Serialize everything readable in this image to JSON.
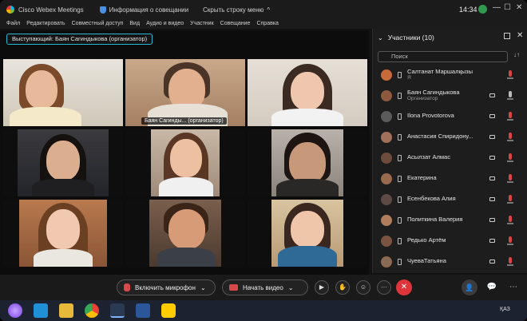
{
  "titlebar": {
    "app_title": "Cisco Webex Meetings",
    "info_label": "Информация о совещании",
    "hide_label": "Скрыть строку меню",
    "hide_chevron": "^",
    "clock": "14:34",
    "minimize": "—",
    "maximize": "☐",
    "close": "✕"
  },
  "menu": [
    "Файл",
    "Редактировать",
    "Совместный доступ",
    "Вид",
    "Аудио и видео",
    "Участник",
    "Совещание",
    "Справка"
  ],
  "stage": {
    "speaker_label": "Выступающий: Баян Сагиндыкова (организатор)",
    "active_tag": "Баян Сагинды... (организатор)"
  },
  "panel": {
    "chevron": "⌄",
    "title": "Участники (10)",
    "popout": "",
    "close": "✕",
    "search_placeholder": "Поиск",
    "sort": "↓↑",
    "participants": [
      {
        "name": "Салтанат Маршалқызы",
        "role": "Я",
        "mic_on": false
      },
      {
        "name": "Баян Сагиндыкова",
        "role": "Организатор",
        "mic_on": true
      },
      {
        "name": "Ilona Provotorova",
        "role": "",
        "mic_on": false
      },
      {
        "name": "Анастасия Спиридону...",
        "role": "",
        "mic_on": false
      },
      {
        "name": "Асылзат Алмас",
        "role": "",
        "mic_on": false
      },
      {
        "name": "Екатерина",
        "role": "",
        "mic_on": false
      },
      {
        "name": "Есенбекова Алия",
        "role": "",
        "mic_on": false
      },
      {
        "name": "Политкина Валерия",
        "role": "",
        "mic_on": false
      },
      {
        "name": "Редько Артём",
        "role": "",
        "mic_on": false
      },
      {
        "name": "ЧуеваТатьяна",
        "role": "",
        "mic_on": false
      }
    ]
  },
  "controls": {
    "mic_label": "Включить микрофон",
    "mic_caret": "⌄",
    "video_label": "Начать видео",
    "video_caret": "⌄",
    "share_icon": "▶",
    "raise_icon": "✋",
    "reactions_icon": "☺",
    "more_icon": "···",
    "end_icon": "✕",
    "participants_icon": "👤",
    "chat_icon": "💬",
    "overflow_icon": "⋯"
  },
  "taskbar": {
    "lang": "ҚАЗ"
  },
  "colors": {
    "accent": "#2bb6d6",
    "end_call": "#e0343b",
    "muted": "#d64646"
  }
}
